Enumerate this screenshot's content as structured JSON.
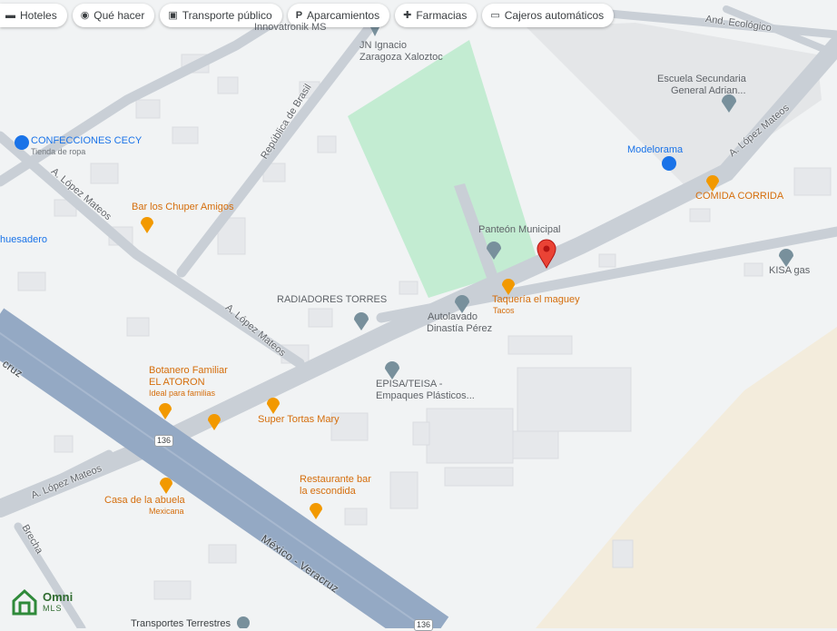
{
  "chips": [
    {
      "icon": "hotel-icon",
      "glyph": "▬",
      "label": "Hoteles"
    },
    {
      "icon": "camera-icon",
      "glyph": "◉",
      "label": "Qué hacer"
    },
    {
      "icon": "bus-icon",
      "glyph": "▣",
      "label": "Transporte público"
    },
    {
      "icon": "parking-icon",
      "glyph": "P",
      "label": "Aparcamientos"
    },
    {
      "icon": "pharmacy-icon",
      "glyph": "✚",
      "label": "Farmacias"
    },
    {
      "icon": "atm-icon",
      "glyph": "▭",
      "label": "Cajeros automáticos"
    }
  ],
  "places": {
    "innovatronik": "Innovatronik MS",
    "jn_ignacio_1": "JN Ignacio",
    "jn_ignacio_2": "Zaragoza Xaloztoc",
    "escuela_1": "Escuela Secundaria",
    "escuela_2": "General Adrian...",
    "confecciones": "CONFECCIONES CECY",
    "confecciones_sub": "Tienda de ropa",
    "modelorama": "Modelorama",
    "comida_corrida": "COMIDA CORRIDA",
    "bar_chuper": "Bar los Chuper Amigos",
    "huesadero": "huesadero",
    "panteon": "Panteón Municipal",
    "kisa": "KISA gas",
    "radiadores": "RADIADORES TORRES",
    "taqueria": "Taquería el maguey",
    "taqueria_sub": "Tacos",
    "autolavado_1": "Autolavado",
    "autolavado_2": "Dinastía Pérez",
    "botanero_1": "Botanero Familiar",
    "botanero_2": "EL ATORON",
    "botanero_sub": "Ideal para familias",
    "episa_1": "EPISA/TEISA -",
    "episa_2": "Empaques Plásticos...",
    "tortas": "Super Tortas Mary",
    "restaurante_1": "Restaurante bar",
    "restaurante_2": "la escondida",
    "casa_abuela": "Casa de la abuela",
    "casa_abuela_sub": "Mexicana",
    "transportes": "Transportes Terrestres"
  },
  "roads": {
    "and_ecologico": "And. Ecológico",
    "rep_brasil": "República de Brasil",
    "lopez_mateos_ne": "A. López Mateos",
    "lopez_mateos_nw": "A. López Mateos",
    "lopez_mateos_mid": "A. López Mateos",
    "lopez_mateos_sw": "A. López Mateos",
    "mexico_veracruz": "México - Veracruz",
    "cruz": "cruz",
    "brecha": "Brecha",
    "shield_1": "136",
    "shield_2": "136"
  },
  "logo": {
    "line1": "Omni",
    "line2": "MLS"
  },
  "colors": {
    "background": "#f1f3f4",
    "park": "#c3ecd2",
    "highway": "#94a9c4",
    "road": "#c9cfd6",
    "sand": "#f3ecdc",
    "pin": "#ea4335",
    "food_pin": "#f29900",
    "place_pin": "#78909c"
  }
}
